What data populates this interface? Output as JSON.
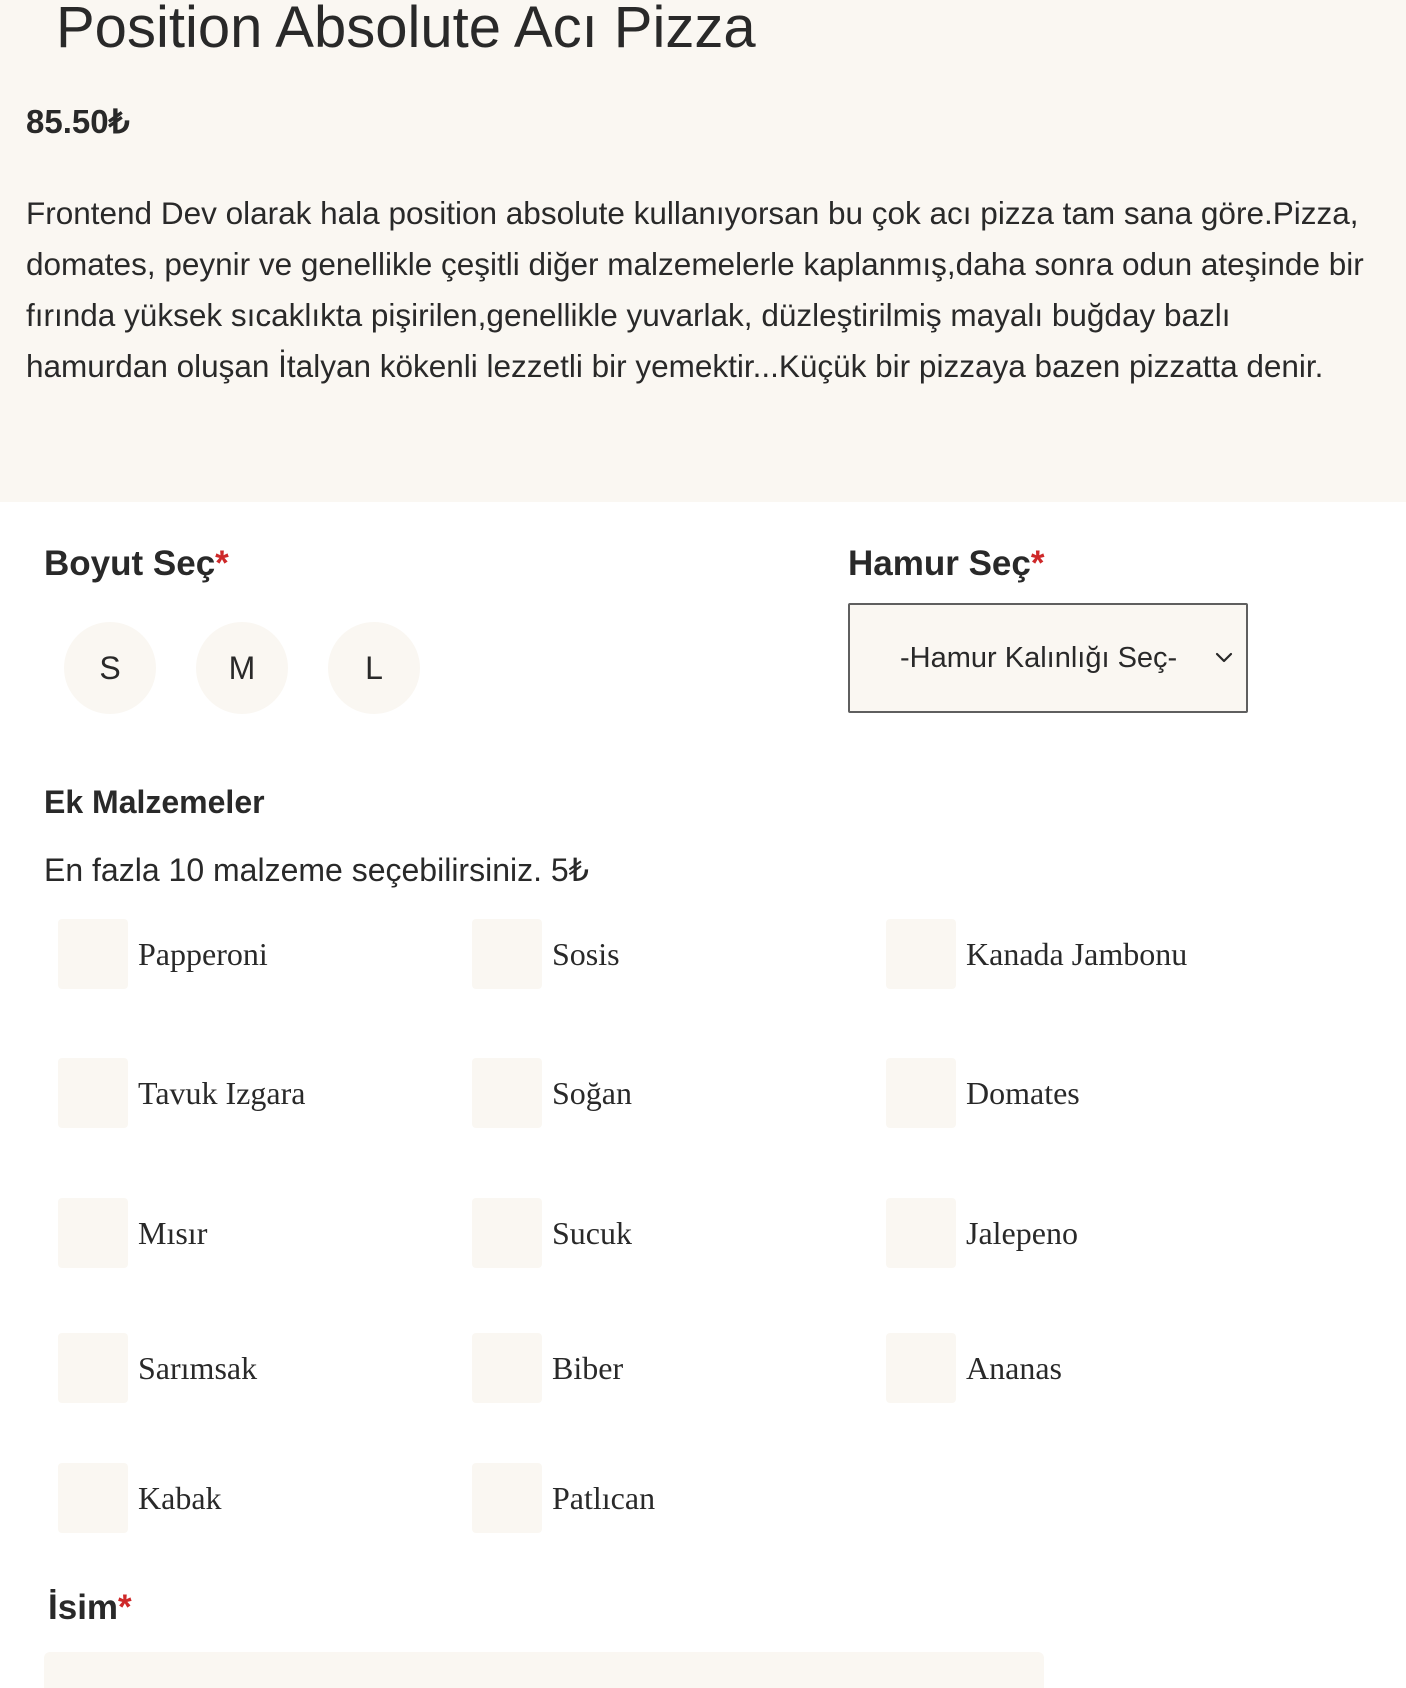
{
  "product": {
    "title": "Position Absolute Acı Pizza",
    "price": "85.50₺",
    "description": "Frontend Dev olarak hala position absolute kullanıyorsan bu çok acı pizza tam sana göre.Pizza, domates, peynir ve genellikle çeşitli diğer malzemelerle kaplanmış,daha sonra odun ateşinde bir fırında yüksek sıcaklıkta pişirilen,genellikle yuvarlak, düzleştirilmiş mayalı buğday bazlı hamurdan oluşan İtalyan kökenli lezzetli bir yemektir...Küçük bir pizzaya bazen pizzatta denir."
  },
  "size": {
    "label": "Boyut Seç",
    "required_mark": "*",
    "options": [
      "S",
      "M",
      "L"
    ]
  },
  "dough": {
    "label": "Hamur Seç",
    "required_mark": "*",
    "selected": "-Hamur Kalınlığı Seç-"
  },
  "extras": {
    "heading": "Ek Malzemeler",
    "note": "En fazla 10 malzeme seçebilirsiniz. 5₺",
    "toppings": [
      "Papperoni",
      "Sosis",
      "Kanada Jambonu",
      "Tavuk Izgara",
      "Soğan",
      "Domates",
      "Mısır",
      "Sucuk",
      "Jalepeno",
      "Sarımsak",
      "Biber",
      "Ananas",
      "Kabak",
      "Patlıcan"
    ]
  },
  "name": {
    "label": "İsim",
    "required_mark": "*",
    "value": ""
  },
  "colors": {
    "background_panel": "#faf7f2",
    "text": "#292929",
    "required": "#ce2829"
  }
}
